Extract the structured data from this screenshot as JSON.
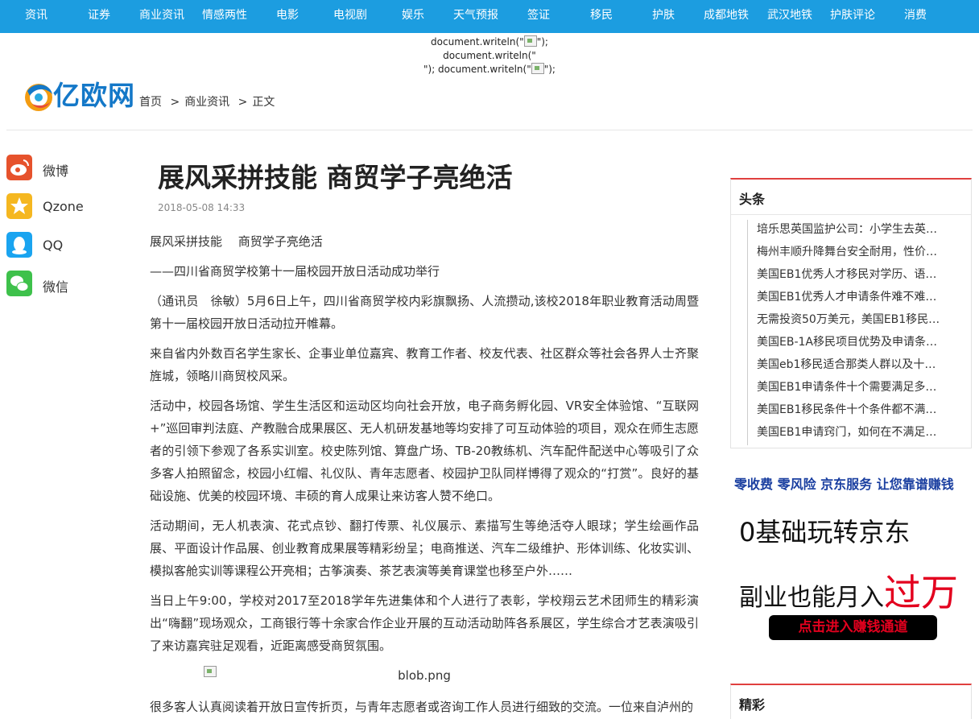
{
  "nav": [
    "资讯",
    "证券",
    "商业资讯",
    "情感两性",
    "电影",
    "电视剧",
    "娱乐",
    "天气预报",
    "签证",
    "移民",
    "护肤",
    "成都地铁",
    "武汉地铁",
    "护肤评论",
    "消费"
  ],
  "docwrite": {
    "part1": "document.writeln(\"",
    "part2": "\"); document.writeln(\"",
    "part3": "\"); document.writeln(\"",
    "part4": "\");"
  },
  "logo": {
    "text": "亿欧网"
  },
  "breadcrumb": {
    "home": "首页",
    "sep": ">",
    "category": "商业资讯",
    "current": "正文"
  },
  "share": [
    {
      "label": "微博",
      "icon": "weibo-icon",
      "color": "#e6522c"
    },
    {
      "label": "Qzone",
      "icon": "qzone-icon",
      "color": "#f5b720"
    },
    {
      "label": "QQ",
      "icon": "qq-icon",
      "color": "#1aa4f0"
    },
    {
      "label": "微信",
      "icon": "wechat-icon",
      "color": "#3ec14b"
    }
  ],
  "article": {
    "title": "展风采拼技能 商贸学子亮绝活",
    "date": "2018-05-08 14:33",
    "paragraphs": [
      "展风采拼技能　 商贸学子亮绝活",
      "——四川省商贸学校第十一届校园开放日活动成功举行",
      "（通讯员　徐敏）5月6日上午，四川省商贸学校内彩旗飘扬、人流攒动,该校2018年职业教育活动周暨第十一届校园开放日活动拉开帷幕。",
      "来自省内外数百名学生家长、企事业单位嘉宾、教育工作者、校友代表、社区群众等社会各界人士齐聚旌城，领略川商贸校风采。",
      "活动中，校园各场馆、学生生活区和运动区均向社会开放，电子商务孵化园、VR安全体验馆、“互联网+”巡回审判法庭、产教融合成果展区、无人机研发基地等均安排了可互动体验的项目，观众在师生志愿者的引领下参观了各系实训室。校史陈列馆、算盘广场、TB-20教练机、汽车配件配送中心等吸引了众多客人拍照留念，校园小红帽、礼仪队、青年志愿者、校园护卫队同样博得了观众的“打赏”。良好的基础设施、优美的校园环境、丰硕的育人成果让来访客人赞不绝口。",
      "活动期间，无人机表演、花式点钞、翻打传票、礼仪展示、素描写生等绝活夺人眼球；学生绘画作品展、平面设计作品展、创业教育成果展等精彩纷呈；电商推送、汽车二级维护、形体训练、化妆实训、模拟客舱实训等课程公开亮相；古筝演奏、茶艺表演等美育课堂也移至户外……",
      "当日上午9:00，学校对2017至2018学年先进集体和个人进行了表彰，学校翔云艺术团师生的精彩演出“嗨翻”现场观众，工商银行等十余家合作企业开展的互动活动助阵各系展区，学生综合才艺表演吸引了来访嘉宾驻足观看，近距离感受商贸氛围。"
    ],
    "image_alt": "blob.png",
    "after_image": "很多客人认真阅读着开放日宣传折页，与青年志愿者或咨询工作人员进行细致的交流。一位来自泸州的"
  },
  "sidebar": {
    "hot_title": "头条",
    "hot_items": [
      "培乐思英国监护公司：小学生去英…",
      "梅州丰顺升降舞台安全耐用，性价…",
      "美国EB1优秀人才移民对学历、语…",
      "美国EB1优秀人才申请条件难不难…",
      "无需投资50万美元，美国EB1移民…",
      "美国EB-1A移民项目优势及申请条…",
      "美国eb1移民适合那类人群以及十…",
      "美国EB1申请条件十个需要满足多…",
      "美国EB1移民条件十个条件都不满…",
      "美国EB1申请窍门，如何在不满足…"
    ],
    "ad": {
      "tagline": "零收费 零风险 京东服务 让您靠谱赚钱",
      "line1": "0基础玩转京东",
      "line2": "副业也能月入",
      "line2_big": "过万",
      "button": "点击进入赚钱通道",
      "accent": "#e3001e"
    },
    "jingcai_title": "精彩"
  },
  "colors": {
    "nav_bg": "#1c9de0",
    "section_accent": "#e0403f",
    "logo_blue": "#1478c8"
  }
}
